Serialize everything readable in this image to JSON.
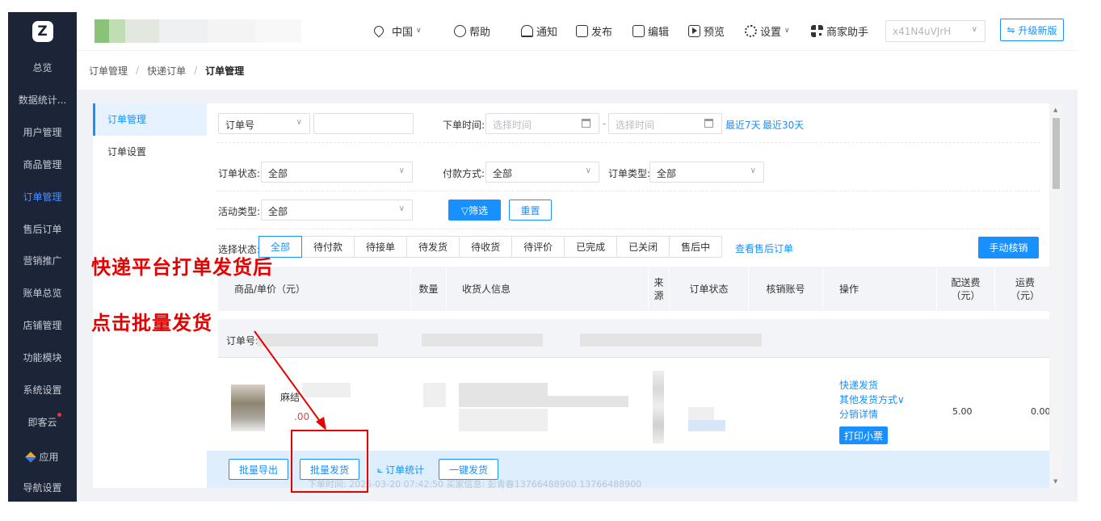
{
  "sidebar": {
    "logo_text": "Z",
    "items": [
      {
        "label": "总览"
      },
      {
        "label": "数据统计..."
      },
      {
        "label": "用户管理"
      },
      {
        "label": "商品管理"
      },
      {
        "label": "订单管理"
      },
      {
        "label": "售后订单"
      },
      {
        "label": "营销推广"
      },
      {
        "label": "账单总览"
      },
      {
        "label": "店铺管理"
      },
      {
        "label": "功能模块"
      },
      {
        "label": "系统设置"
      },
      {
        "label": "即客云"
      },
      {
        "label": "应用"
      },
      {
        "label": "导航设置"
      }
    ],
    "active_index": 4
  },
  "header": {
    "region": "中国",
    "help": "帮助",
    "notify": "通知",
    "publish": "发布",
    "edit": "编辑",
    "preview": "预览",
    "settings": "设置",
    "merchant_assistant": "商家助手",
    "account_id": "x41N4uVJrH",
    "upgrade": "升级新版"
  },
  "breadcrumb": {
    "items": [
      "订单管理",
      "快递订单",
      "订单管理"
    ]
  },
  "subnav": {
    "items": [
      "订单管理",
      "订单设置"
    ]
  },
  "filters": {
    "order_no_select": "订单号",
    "order_time_label": "下单时间:",
    "time_placeholder": "选择时间",
    "time_sep": "-",
    "last7": "最近7天",
    "last30": "最近30天",
    "order_status_label": "订单状态:",
    "order_status_value": "全部",
    "pay_method_label": "付款方式:",
    "pay_method_value": "全部",
    "order_type_label": "订单类型:",
    "order_type_value": "全部",
    "activity_type_label": "活动类型:",
    "activity_type_value": "全部",
    "filter_btn": "▽筛选",
    "reset_btn": "重置"
  },
  "status_tabs": {
    "label": "选择状态:",
    "tabs": [
      "全部",
      "待付款",
      "待接单",
      "待发货",
      "待收货",
      "待评价",
      "已完成",
      "已关闭",
      "售后中"
    ],
    "view_aftersale": "查看售后订单",
    "manual_verify": "手动核销"
  },
  "table": {
    "headers": {
      "product": "商品/单价（元）",
      "qty": "数量",
      "receiver": "收货人信息",
      "source": "来源",
      "order_status": "订单状态",
      "verify_account": "核销账号",
      "actions": "操作",
      "delivery_fee": "配送费（元）",
      "freight": "运费（元）"
    },
    "order_no_label": "订单号:",
    "row": {
      "product_name_partial": "麻结",
      "price_partial": ".00",
      "action_express": "快递发货",
      "action_other": "其他发货方式",
      "action_distribution": "分销详情",
      "action_print": "打印小票",
      "delivery_fee": "5.00",
      "freight": "0.00"
    }
  },
  "bottom_bar": {
    "batch_export": "批量导出",
    "batch_ship": "批量发货",
    "order_stats": "订单统计",
    "one_click_ship": "一键发货",
    "faint_text": "下单时间: 2025-03-20 07:42:50      买家信息: 彭青春13766488900 13766488900"
  },
  "annotations": {
    "line1": "快递平台打单发货后",
    "line2": "点击批量发货"
  }
}
